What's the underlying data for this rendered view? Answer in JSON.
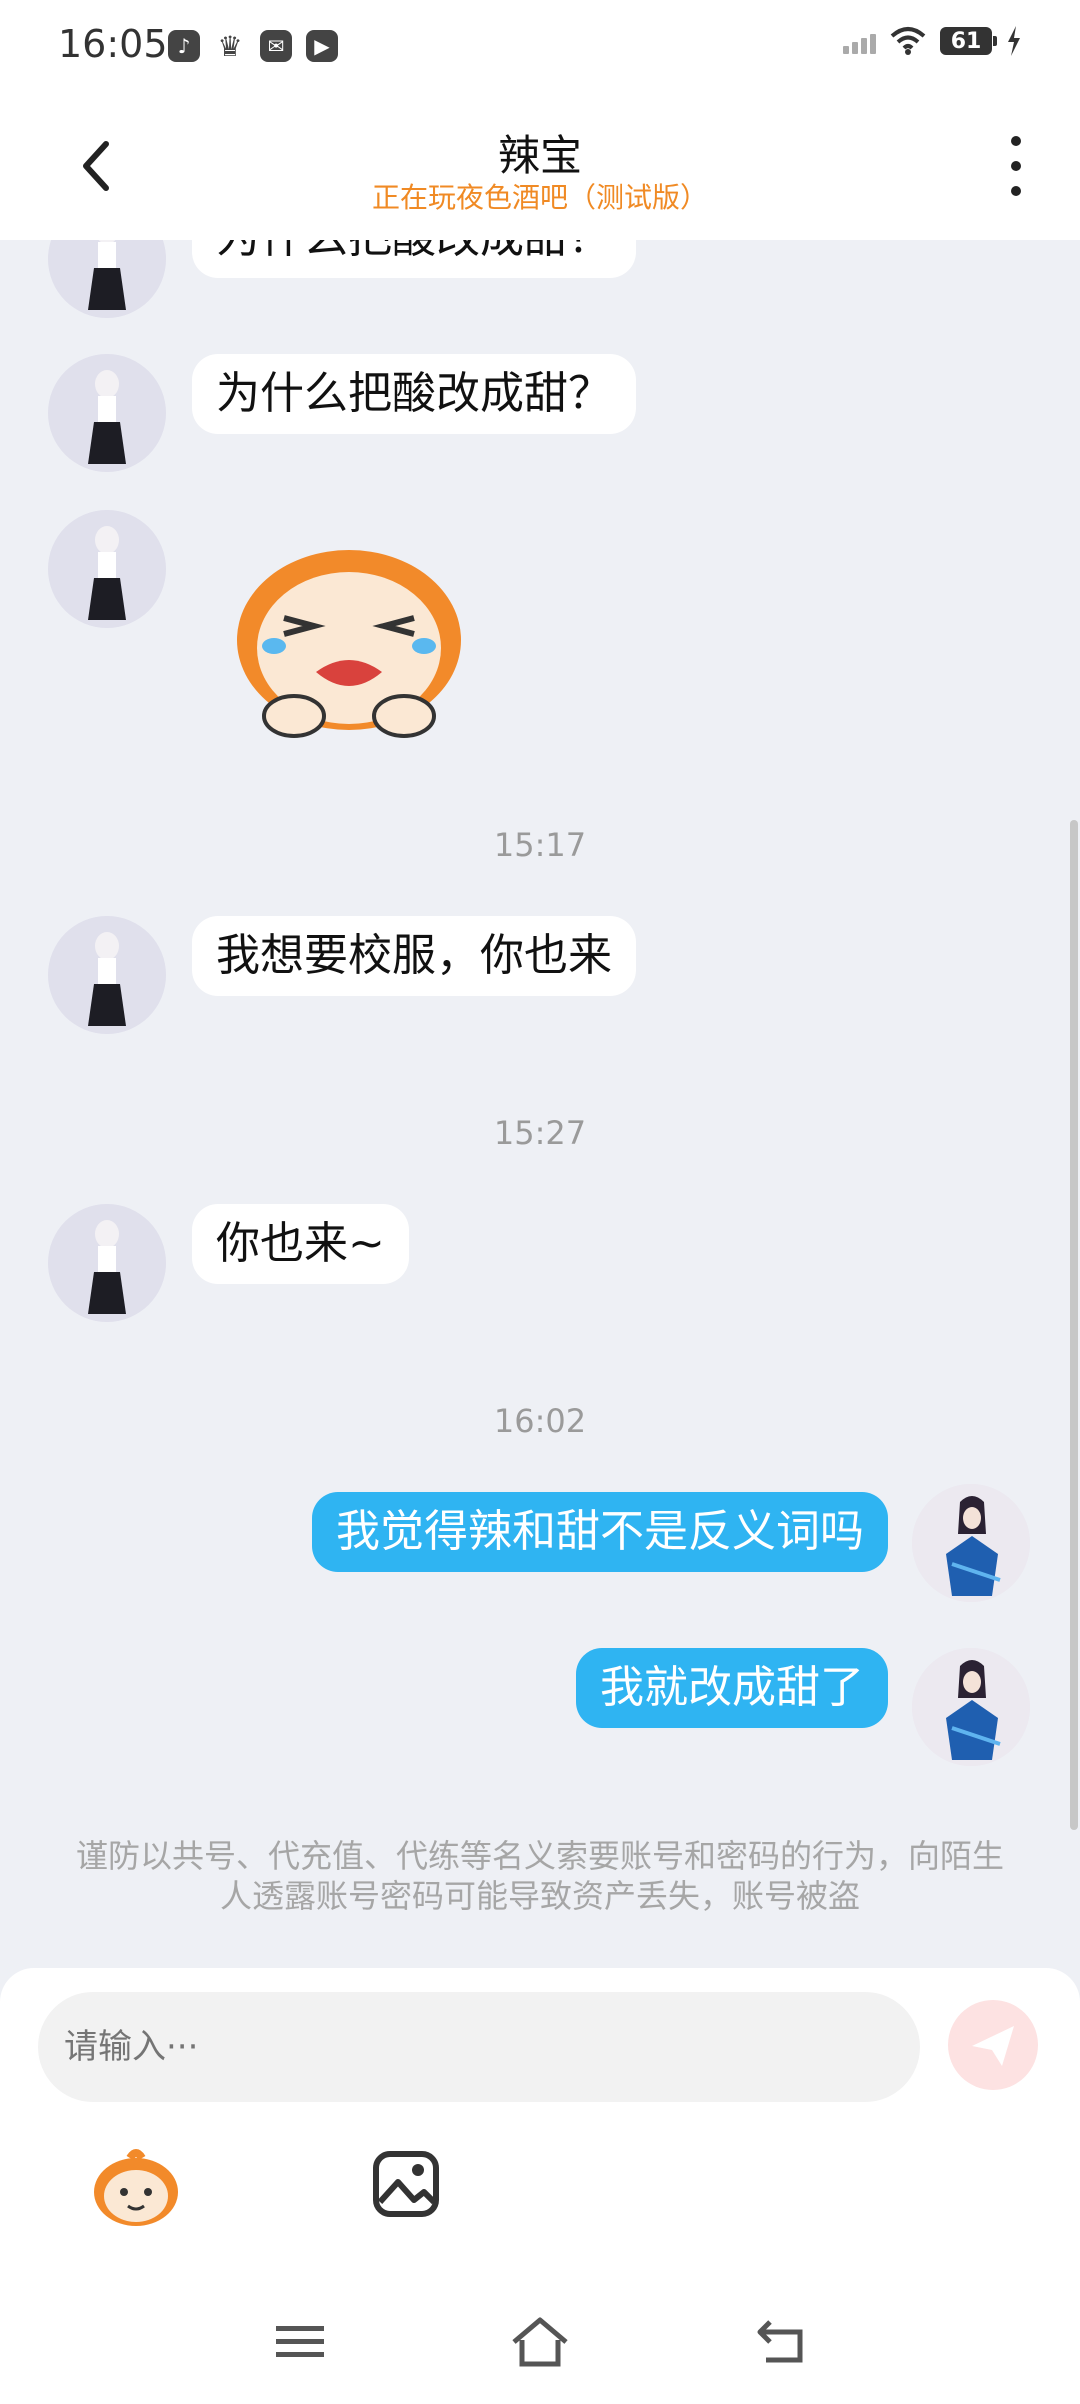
{
  "status_bar": {
    "time": "16:05",
    "battery": "61",
    "icons": [
      "music-icon",
      "crown-icon",
      "mail-icon",
      "play-icon"
    ]
  },
  "header": {
    "title": "辣宝",
    "subtitle": "正在玩夜色酒吧（测试版）"
  },
  "messages": {
    "m0": "为什么把酸改成甜？",
    "m1": "为什么把酸改成甜？",
    "m3": "我想要校服，你也来",
    "m4": "你也来~",
    "m5": "我觉得辣和甜不是反义词吗",
    "m6": "我就改成甜了"
  },
  "timestamps": {
    "t1": "15:17",
    "t2": "15:27",
    "t3": "16:02"
  },
  "notice": "谨防以共号、代充值、代练等名义索要账号和密码的行为，向陌生人透露账号密码可能导致资产丢失，账号被盗",
  "composer": {
    "placeholder": "请输入···"
  },
  "colors": {
    "accent_blue": "#2fb4f2",
    "subtitle_orange": "#f08a24",
    "background": "#eef0f5"
  }
}
